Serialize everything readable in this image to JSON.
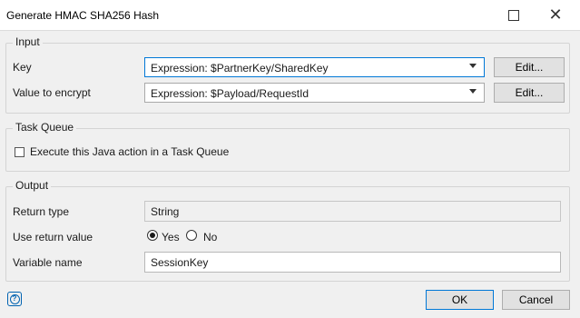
{
  "window": {
    "title": "Generate HMAC SHA256 Hash",
    "maximize_icon": "maximize-icon",
    "close_icon": "close-icon",
    "close_glyph": "✕"
  },
  "input_group": {
    "legend": "Input",
    "key_label": "Key",
    "key_value": "Expression: $PartnerKey/SharedKey",
    "key_edit": "Edit...",
    "value_label": "Value to encrypt",
    "value_value": "Expression: $Payload/RequestId",
    "value_edit": "Edit..."
  },
  "task_queue_group": {
    "legend": "Task Queue",
    "checkbox_label": "Execute this Java action in a Task Queue",
    "checked": false
  },
  "output_group": {
    "legend": "Output",
    "return_type_label": "Return type",
    "return_type_value": "String",
    "use_return_label": "Use return value",
    "yes_label": "Yes",
    "no_label": "No",
    "selected": "Yes",
    "variable_label": "Variable name",
    "variable_value": "SessionKey"
  },
  "footer": {
    "help_icon": "help-icon",
    "help_glyph": "?",
    "ok_label": "OK",
    "cancel_label": "Cancel"
  },
  "colors": {
    "accent": "#0078d7",
    "background": "#f0f0f0"
  }
}
